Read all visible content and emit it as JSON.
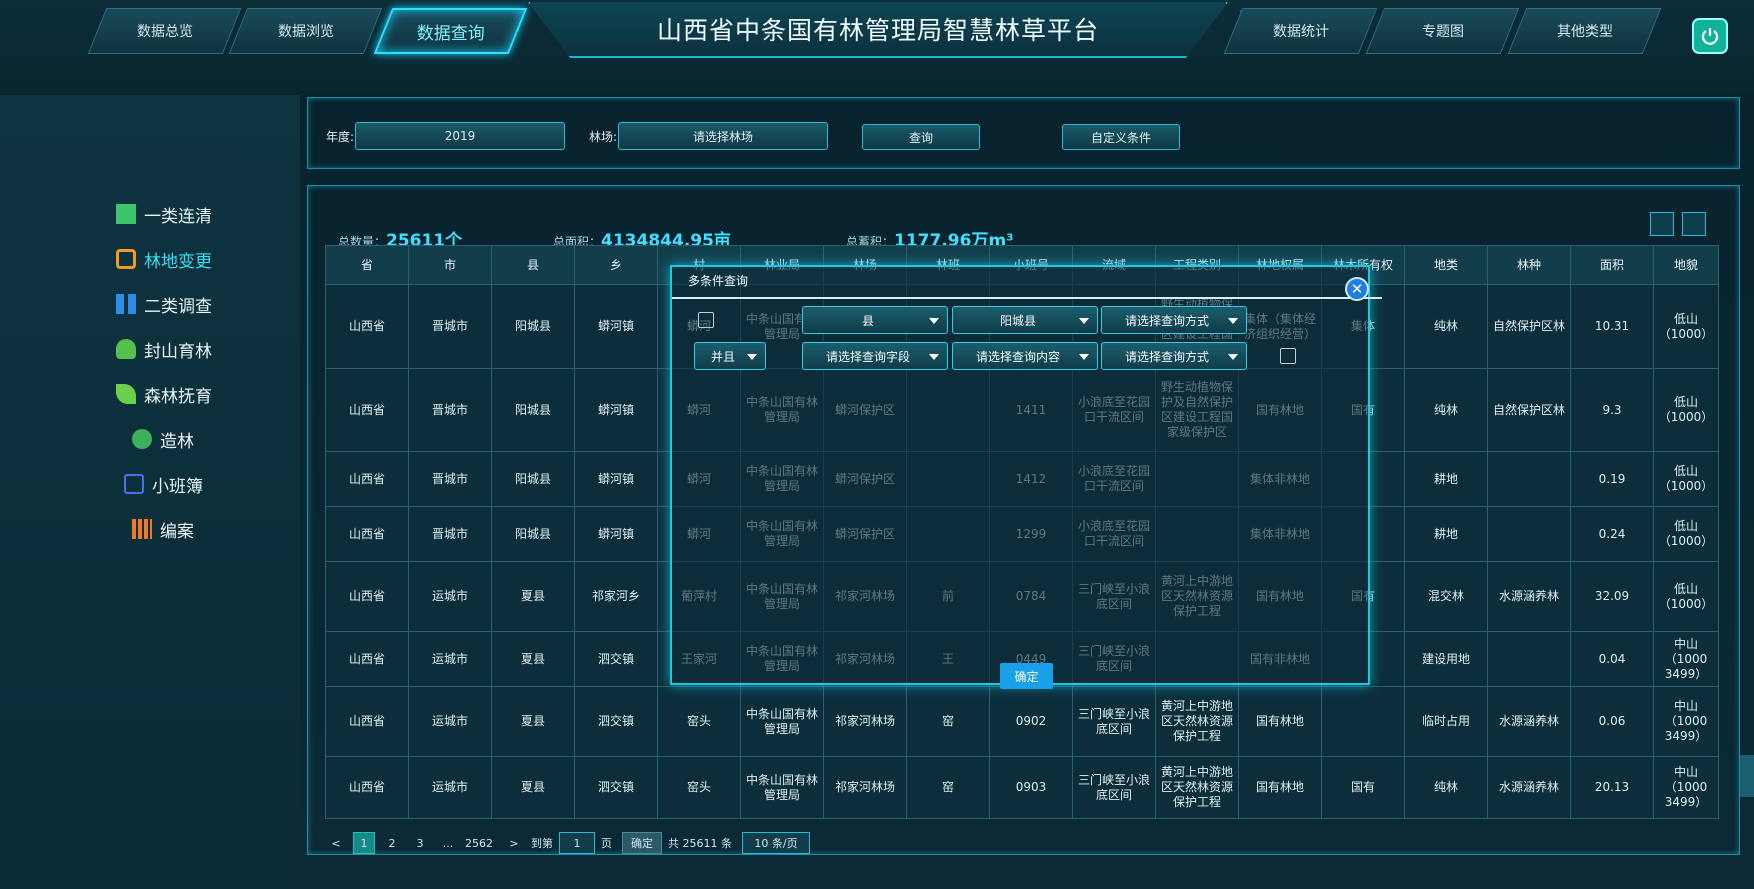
{
  "header": {
    "title": "山西省中条国有林管理局智慧林草平台",
    "tabs": [
      "数据总览",
      "数据浏览",
      "数据查询",
      "数据统计",
      "专题图",
      "其他类型"
    ],
    "active_tab": "数据查询"
  },
  "sidebar": {
    "items": [
      "一类连清",
      "林地变更",
      "二类调查",
      "封山育林",
      "森林抚育",
      "造林",
      "小班簿",
      "编案"
    ],
    "active": "林地变更"
  },
  "filter": {
    "year_label": "年度:",
    "year_value": "2019",
    "forest_label": "林场:",
    "forest_value": "请选择林场",
    "query_button": "查询",
    "custom_button": "自定义条件"
  },
  "stats": {
    "count_label": "总数量：",
    "count_value": "25611个",
    "area_label": "总面积：",
    "area_value": "4134844.95亩",
    "volume_label": "总蓄积：",
    "volume_value": "1177.96万m³"
  },
  "table": {
    "headers": [
      "省",
      "市",
      "县",
      "乡",
      "村",
      "林业局",
      "林场",
      "林班",
      "小班号",
      "流域",
      "工程类别",
      "林地权属",
      "林木所有权",
      "地类",
      "林种",
      "面积",
      "地貌"
    ],
    "rows": [
      [
        "山西省",
        "晋城市",
        "阳城县",
        "蟒河镇",
        "蟒河",
        "中条山国有林管理局",
        "蟒河保护区",
        "",
        "",
        "",
        "野生动植物保护及自然保护区建设工程国家级",
        "集体（集体经济组织经营）",
        "集体",
        "纯林",
        "自然保护区林",
        "10.31",
        "低山（1000）"
      ],
      [
        "山西省",
        "晋城市",
        "阳城县",
        "蟒河镇",
        "蟒河",
        "中条山国有林管理局",
        "蟒河保护区",
        "",
        "1411",
        "小浪底至花园口干流区间",
        "野生动植物保护及自然保护区建设工程国家级保护区",
        "国有林地",
        "国有",
        "纯林",
        "自然保护区林",
        "9.3",
        "低山（1000）"
      ],
      [
        "山西省",
        "晋城市",
        "阳城县",
        "蟒河镇",
        "蟒河",
        "中条山国有林管理局",
        "蟒河保护区",
        "",
        "1412",
        "小浪底至花园口干流区间",
        "",
        "集体非林地",
        "",
        "耕地",
        "",
        "0.19",
        "低山（1000）"
      ],
      [
        "山西省",
        "晋城市",
        "阳城县",
        "蟒河镇",
        "蟒河",
        "中条山国有林管理局",
        "蟒河保护区",
        "",
        "1299",
        "小浪底至花园口干流区间",
        "",
        "集体非林地",
        "",
        "耕地",
        "",
        "0.24",
        "低山（1000）"
      ],
      [
        "山西省",
        "运城市",
        "夏县",
        "祁家河乡",
        "葡萍村",
        "中条山国有林管理局",
        "祁家河林场",
        "前",
        "0784",
        "三门峡至小浪底区间",
        "黄河上中游地区天然林资源保护工程",
        "国有林地",
        "国有",
        "混交林",
        "水源涵养林",
        "32.09",
        "低山（1000）"
      ],
      [
        "山西省",
        "运城市",
        "夏县",
        "泗交镇",
        "王家河",
        "中条山国有林管理局",
        "祁家河林场",
        "王",
        "0449",
        "三门峡至小浪底区间",
        "",
        "国有非林地",
        "",
        "建设用地",
        "",
        "0.04",
        "中山（1000 3499）"
      ],
      [
        "山西省",
        "运城市",
        "夏县",
        "泗交镇",
        "窑头",
        "中条山国有林管理局",
        "祁家河林场",
        "窑",
        "0902",
        "三门峡至小浪底区间",
        "黄河上中游地区天然林资源保护工程",
        "国有林地",
        "",
        "临时占用",
        "水源涵养林",
        "0.06",
        "中山（1000 3499）"
      ],
      [
        "山西省",
        "运城市",
        "夏县",
        "泗交镇",
        "窑头",
        "中条山国有林管理局",
        "祁家河林场",
        "窑",
        "0903",
        "三门峡至小浪底区间",
        "黄河上中游地区天然林资源保护工程",
        "国有林地",
        "国有",
        "纯林",
        "水源涵养林",
        "20.13",
        "中山（1000 3499）"
      ]
    ]
  },
  "pager": {
    "prev": "<",
    "pages": [
      "1",
      "2",
      "3",
      "...",
      "2562"
    ],
    "next": ">",
    "goto_label": "到第",
    "goto_value": "1",
    "page_unit": "页",
    "confirm": "确定",
    "total": "共 25611 条",
    "page_size": "10 条/页"
  },
  "modal": {
    "title": "多条件查询",
    "row1": [
      "县",
      "阳城县",
      "请选择查询方式"
    ],
    "row2": [
      "并且",
      "请选择查询字段",
      "请选择查询内容",
      "请选择查询方式"
    ],
    "ok": "确定"
  }
}
